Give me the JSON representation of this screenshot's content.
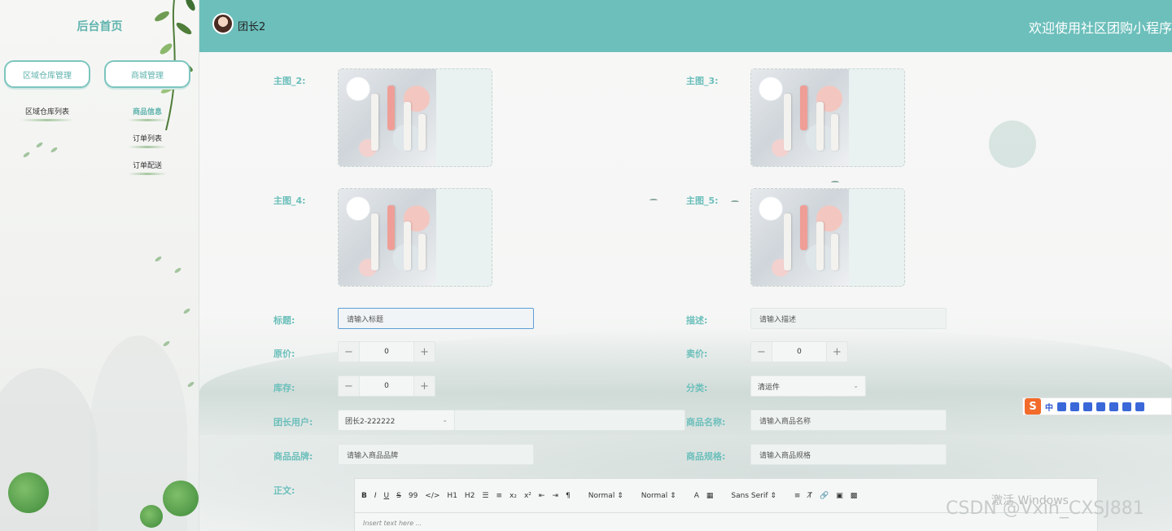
{
  "sidebar": {
    "home": "后台首页",
    "menus": [
      {
        "label": "区域仓库管理",
        "items": [
          "区域仓库列表"
        ]
      },
      {
        "label": "商城管理",
        "items": [
          "商品信息",
          "订单列表",
          "订单配送"
        ]
      }
    ]
  },
  "header": {
    "username": "团长2",
    "welcome": "欢迎使用社区团购小程序"
  },
  "form": {
    "img2_label": "主图_2:",
    "img3_label": "主图_3:",
    "img4_label": "主图_4:",
    "img5_label": "主图_5:",
    "title_label": "标题:",
    "title_placeholder": "请输入标题",
    "desc_label": "描述:",
    "desc_placeholder": "请输入描述",
    "orig_price_label": "原价:",
    "orig_price_value": "0",
    "sale_price_label": "卖价:",
    "sale_price_value": "0",
    "stock_label": "库存:",
    "stock_value": "0",
    "category_label": "分类:",
    "category_value": "清运件",
    "leader_label": "团长用户:",
    "leader_value": "团长2-222222",
    "product_name_label": "商品名称:",
    "product_name_placeholder": "请输入商品名称",
    "brand_label": "商品品牌:",
    "brand_placeholder": "请输入商品品牌",
    "spec_label": "商品规格:",
    "spec_placeholder": "请输入商品规格",
    "body_label": "正文:"
  },
  "editor": {
    "toolbar": {
      "bold": "B",
      "italic": "I",
      "underline": "U",
      "strike": "S",
      "quote": "99",
      "code": "</>",
      "h1": "H1",
      "h2": "H2",
      "size": "Normal",
      "header": "Normal",
      "font": "Sans Serif"
    },
    "placeholder": "Insert text here ..."
  },
  "overlay": {
    "activate_windows": "激活 Windows",
    "watermark": "CSDN @Vxin_CXSJ881",
    "ime_label": "中"
  }
}
